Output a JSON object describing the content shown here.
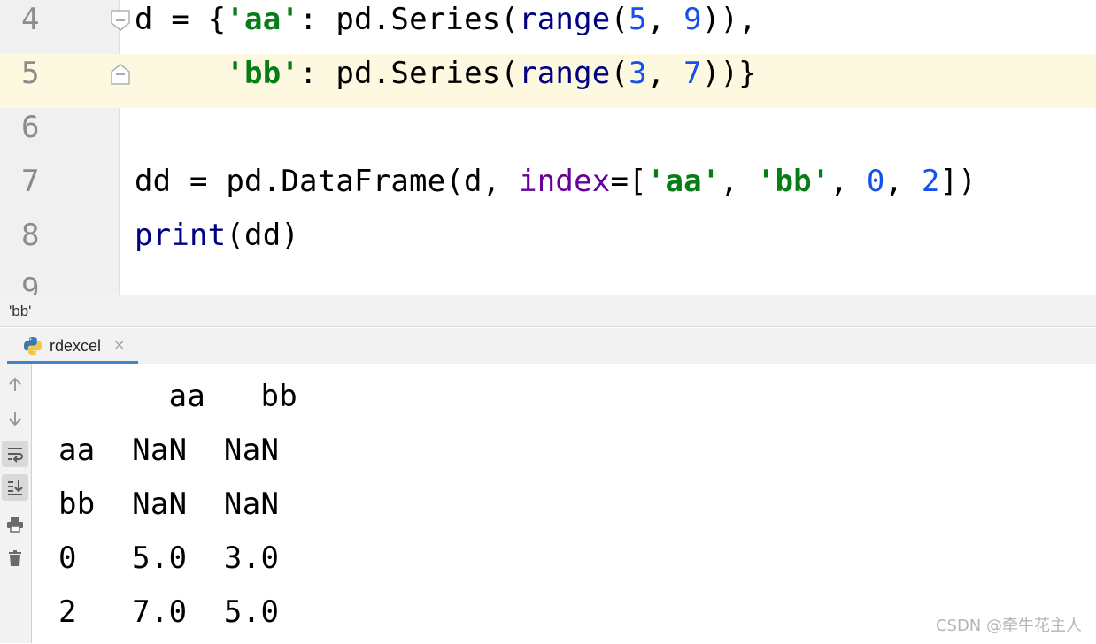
{
  "editor": {
    "current_line": "5",
    "lines": [
      {
        "num": "4",
        "tokens": [
          {
            "t": "d = {",
            "c": "plain"
          },
          {
            "t": "'aa'",
            "c": "str"
          },
          {
            "t": ": pd.Series(",
            "c": "plain"
          },
          {
            "t": "range",
            "c": "builtin"
          },
          {
            "t": "(",
            "c": "plain"
          },
          {
            "t": "5",
            "c": "num"
          },
          {
            "t": ", ",
            "c": "plain"
          },
          {
            "t": "9",
            "c": "num"
          },
          {
            "t": ")),",
            "c": "plain"
          }
        ]
      },
      {
        "num": "5",
        "tokens": [
          {
            "t": "     ",
            "c": "plain"
          },
          {
            "t": "'bb'",
            "c": "str"
          },
          {
            "t": ": pd.Series(",
            "c": "plain"
          },
          {
            "t": "range",
            "c": "builtin"
          },
          {
            "t": "(",
            "c": "plain"
          },
          {
            "t": "3",
            "c": "num"
          },
          {
            "t": ", ",
            "c": "plain"
          },
          {
            "t": "7",
            "c": "num"
          },
          {
            "t": "))}",
            "c": "plain"
          }
        ]
      },
      {
        "num": "6",
        "tokens": []
      },
      {
        "num": "7",
        "tokens": [
          {
            "t": "dd = pd.DataFrame(d, ",
            "c": "plain"
          },
          {
            "t": "index",
            "c": "kw"
          },
          {
            "t": "=[",
            "c": "plain"
          },
          {
            "t": "'aa'",
            "c": "str"
          },
          {
            "t": ", ",
            "c": "plain"
          },
          {
            "t": "'bb'",
            "c": "str"
          },
          {
            "t": ", ",
            "c": "plain"
          },
          {
            "t": "0",
            "c": "num"
          },
          {
            "t": ", ",
            "c": "plain"
          },
          {
            "t": "2",
            "c": "num"
          },
          {
            "t": "])",
            "c": "plain"
          }
        ]
      },
      {
        "num": "8",
        "tokens": [
          {
            "t": "print",
            "c": "builtin"
          },
          {
            "t": "(dd)",
            "c": "plain"
          }
        ]
      },
      {
        "num": "9",
        "tokens": []
      }
    ]
  },
  "breadcrumb": "'bb'",
  "run": {
    "tab_label": "rdexcel",
    "tab_close": "×",
    "toolbar_icons": [
      "arrow-up-icon",
      "arrow-down-icon",
      "soft-wrap-icon",
      "scroll-to-end-icon",
      "print-icon",
      "trash-icon"
    ],
    "output": [
      "      aa   bb",
      "aa  NaN  NaN",
      "bb  NaN  NaN",
      "0   5.0  3.0",
      "2   7.0  5.0"
    ]
  },
  "watermark": "CSDN @牵牛花主人",
  "colors": {
    "string": "#067d17",
    "number": "#1750eb",
    "builtin": "#000080",
    "keyword_arg": "#660099",
    "current_line_bg": "#fdf8e0",
    "tab_underline": "#4083c9"
  }
}
